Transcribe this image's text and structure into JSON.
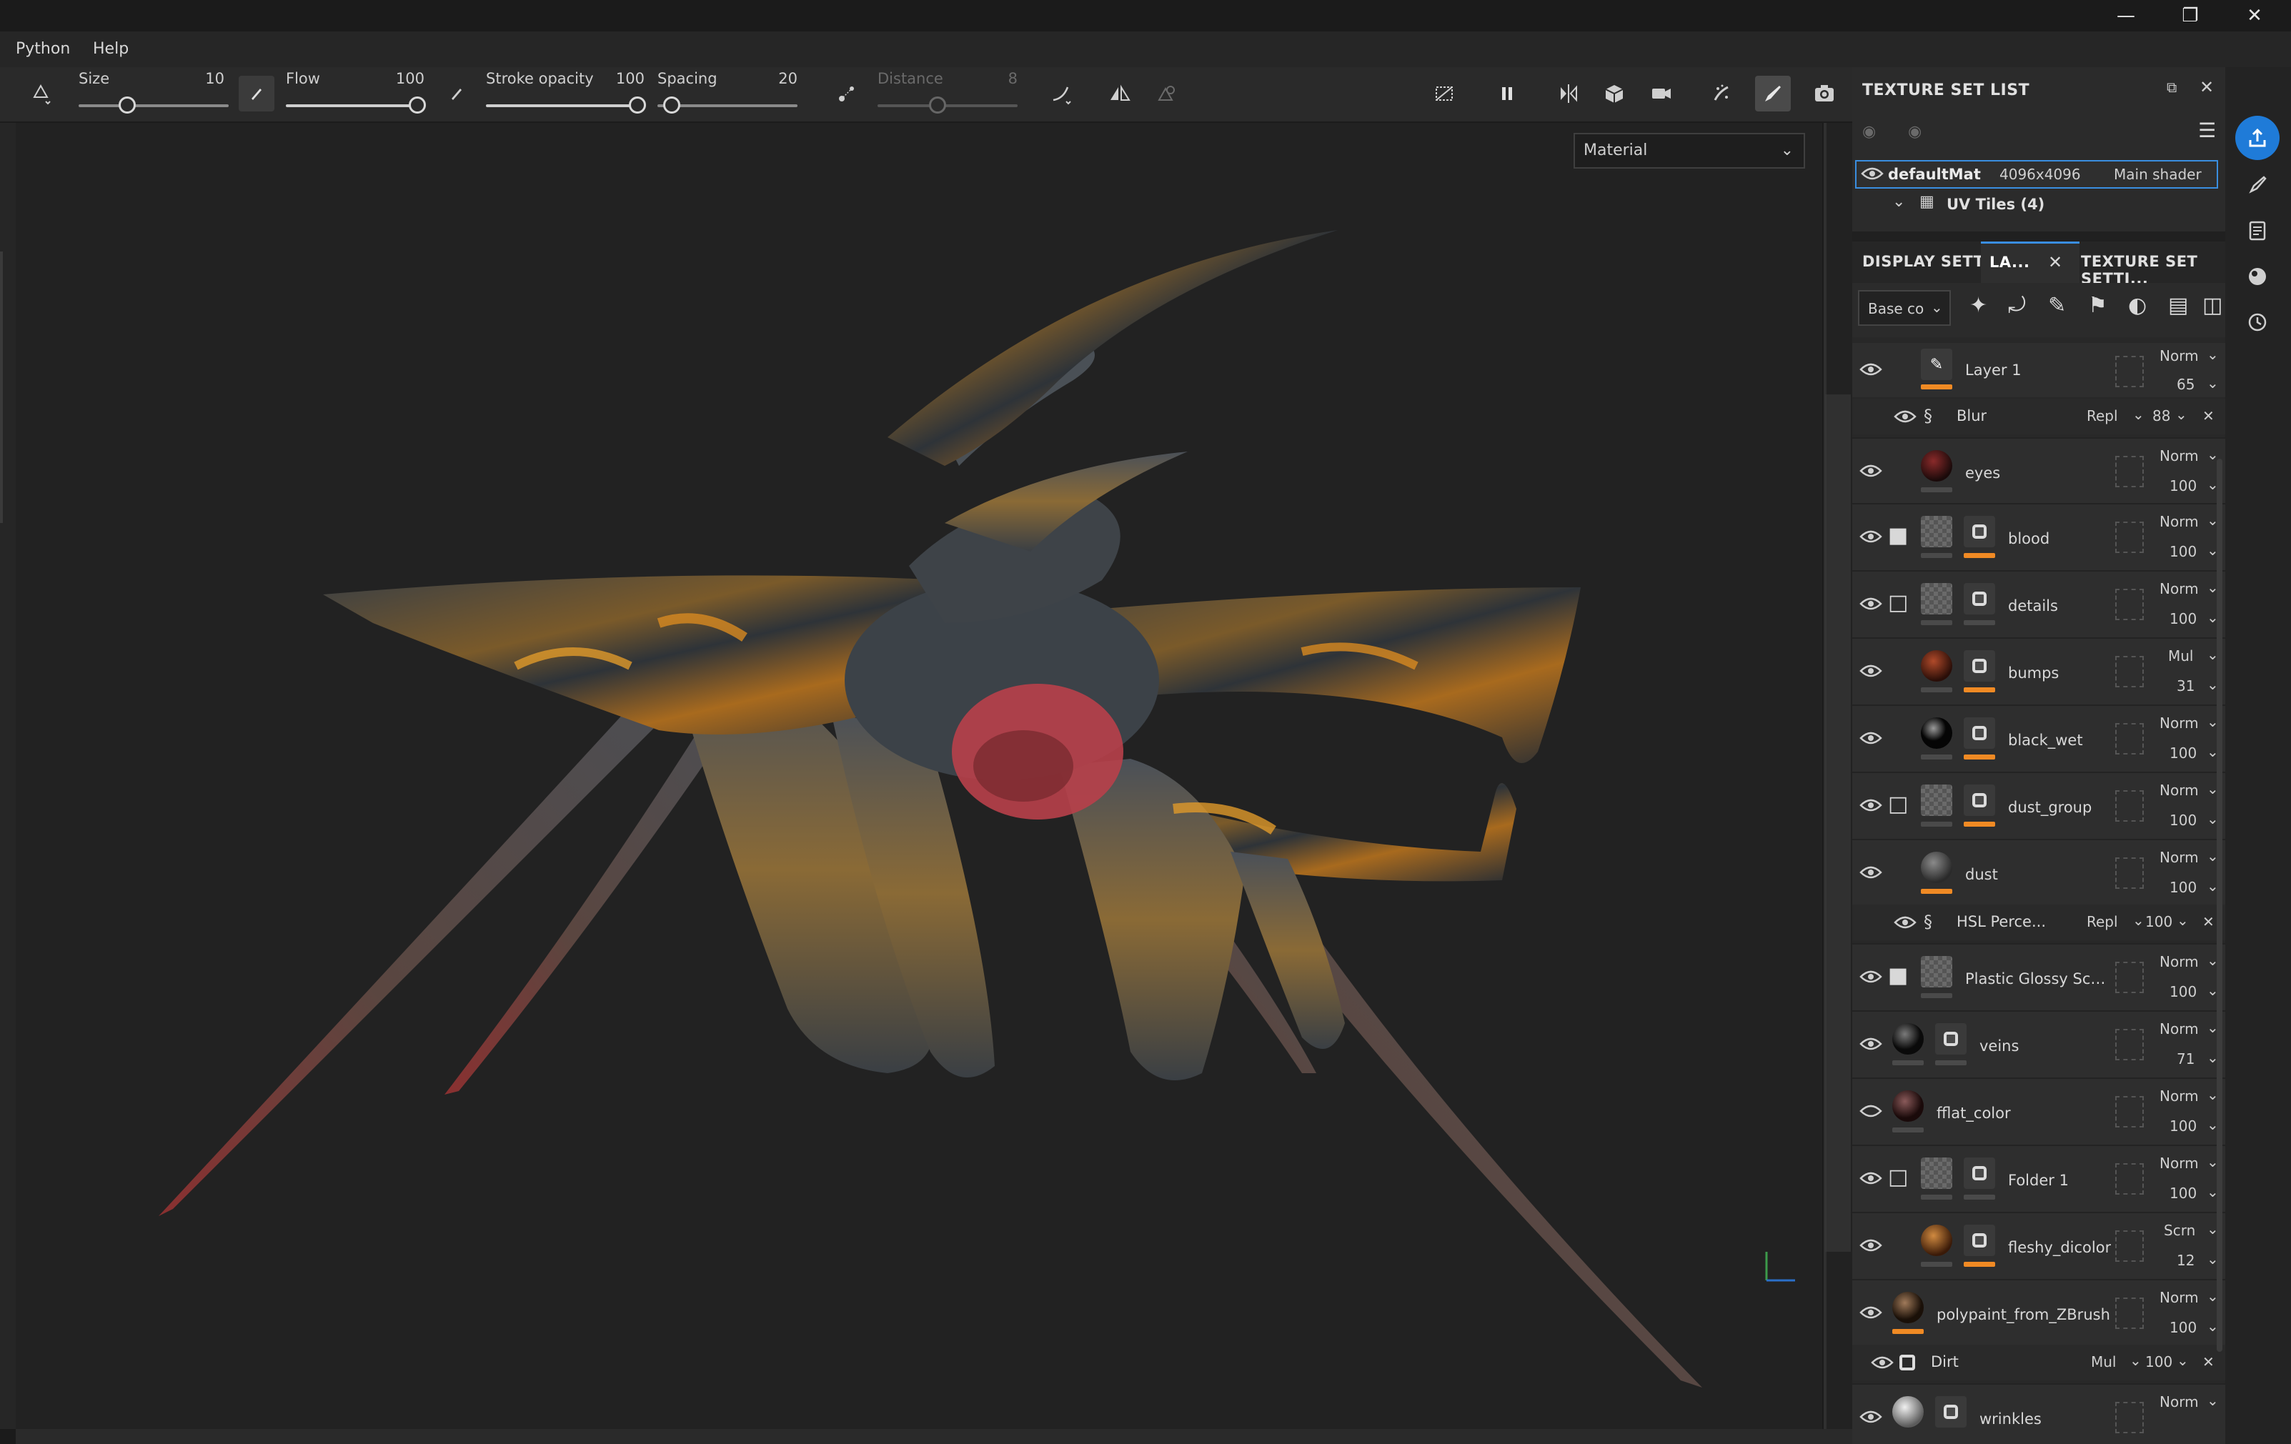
{
  "menu": [
    "Python",
    "Help"
  ],
  "toolbar": {
    "size_label": "Size",
    "size_value": "10",
    "flow_label": "Flow",
    "flow_value": "100",
    "opacity_label": "Stroke opacity",
    "opacity_value": "100",
    "spacing_label": "Spacing",
    "spacing_value": "20",
    "distance_label": "Distance",
    "distance_value": "8"
  },
  "viewport": {
    "channel_select": "Material"
  },
  "texture_set_list": {
    "title": "TEXTURE SET LIST",
    "material": {
      "name": "defaultMat",
      "resolution": "4096x4096",
      "shader": "Main shader"
    },
    "uv_tiles": "UV Tiles (4)"
  },
  "tabs": [
    "DISPLAY SETTI...",
    "LA...",
    "TEXTURE SET SETTI..."
  ],
  "layers_toolbar": {
    "channel": "Base co"
  },
  "layers": [
    {
      "name": "Layer 1",
      "blend": "Norm",
      "opacity": "65",
      "visible": true
    },
    {
      "name": "eyes",
      "blend": "Norm",
      "opacity": "100",
      "visible": true
    },
    {
      "name": "blood",
      "blend": "Norm",
      "opacity": "100",
      "visible": true
    },
    {
      "name": "details",
      "blend": "Norm",
      "opacity": "100",
      "visible": true
    },
    {
      "name": "bumps",
      "blend": "Mul",
      "opacity": "31",
      "visible": true
    },
    {
      "name": "black_wet",
      "blend": "Norm",
      "opacity": "100",
      "visible": true
    },
    {
      "name": "dust_group",
      "blend": "Norm",
      "opacity": "100",
      "visible": true
    },
    {
      "name": "dust",
      "blend": "Norm",
      "opacity": "100",
      "visible": true
    },
    {
      "name": "Plastic Glossy Scuff...",
      "blend": "Norm",
      "opacity": "100",
      "visible": true
    },
    {
      "name": "veins",
      "blend": "Norm",
      "opacity": "71",
      "visible": true
    },
    {
      "name": "fflat_color",
      "blend": "Norm",
      "opacity": "100",
      "visible": false
    },
    {
      "name": "Folder 1",
      "blend": "Norm",
      "opacity": "100",
      "visible": true
    },
    {
      "name": "fleshy_dicolor",
      "blend": "Scrn",
      "opacity": "12",
      "visible": true
    },
    {
      "name": "polypaint_from_ZBrush",
      "blend": "Norm",
      "opacity": "100",
      "visible": true
    },
    {
      "name": "wrinkles",
      "blend": "Norm",
      "opacity": "",
      "visible": true
    }
  ],
  "effects": [
    {
      "name": "Blur",
      "blend": "Repl",
      "opacity": "88"
    },
    {
      "name": "HSL Perce...",
      "blend": "Repl",
      "opacity": "100"
    },
    {
      "name": "Dirt",
      "blend": "Mul",
      "opacity": "100"
    }
  ],
  "colors": {
    "accent": "#f08a24",
    "highlight": "#1f7bd8",
    "panel": "#2b2b2b"
  }
}
